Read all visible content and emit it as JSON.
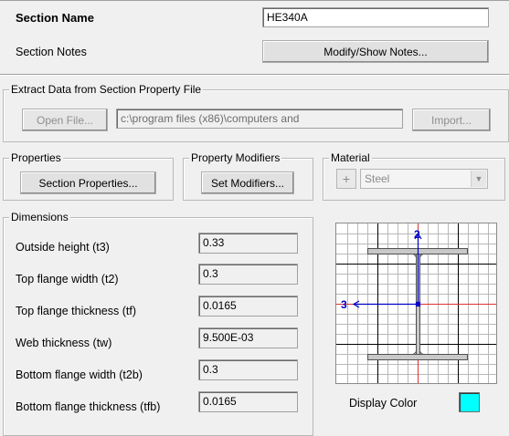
{
  "section": {
    "name_label": "Section Name",
    "name_value": "HE340A",
    "notes_label": "Section Notes",
    "notes_button": "Modify/Show Notes..."
  },
  "extract": {
    "title": "Extract Data from Section Property File",
    "open_button": "Open File...",
    "path_value": "c:\\program files (x86)\\computers and",
    "import_button": "Import..."
  },
  "properties": {
    "title": "Properties",
    "button": "Section Properties..."
  },
  "modifiers": {
    "title": "Property Modifiers",
    "button": "Set Modifiers..."
  },
  "material": {
    "title": "Material",
    "plus_label": "+",
    "selected": "Steel"
  },
  "dimensions": {
    "title": "Dimensions",
    "rows": [
      {
        "label": "Outside height  (t3)",
        "value": "0.33"
      },
      {
        "label": "Top flange width  (t2)",
        "value": "0.3"
      },
      {
        "label": "Top flange thickness  (tf)",
        "value": "0.0165"
      },
      {
        "label": "Web thickness  (tw)",
        "value": "9.500E-03"
      },
      {
        "label": "Bottom flange width  (t2b)",
        "value": "0.3"
      },
      {
        "label": "Bottom flange thickness  (tfb)",
        "value": "0.0165"
      }
    ]
  },
  "preview": {
    "axis2_label": "2",
    "axis3_label": "3"
  },
  "display_color": {
    "label": "Display Color",
    "color": "#00ffff"
  }
}
